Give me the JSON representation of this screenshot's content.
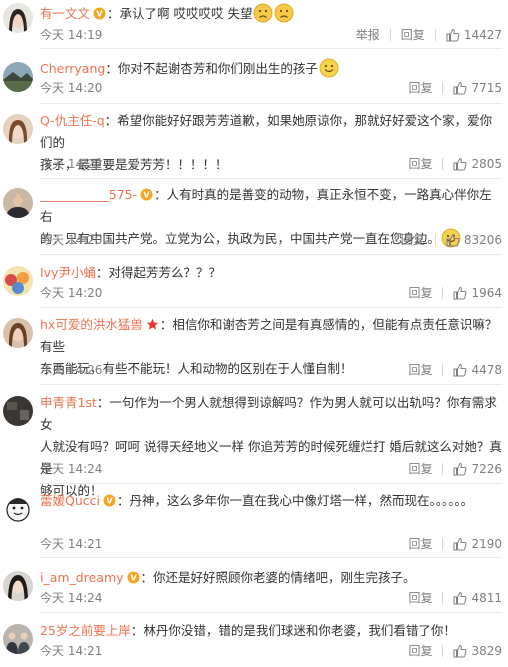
{
  "actions": {
    "report": "举报",
    "reply": "回复"
  },
  "comments": [
    {
      "user": "有一文文",
      "text": "：承认了啊 哎哎哎哎 失望",
      "lines": [
        "：承认了啊 哎哎哎哎 失望"
      ],
      "emoji": [
        "sad-face",
        "sad-face"
      ],
      "time": "今天 14:19",
      "likes": "14427",
      "show_report": true,
      "avatar": "woman-dark-hair"
    },
    {
      "user": "Cherryang",
      "text": "：你对不起谢杏芳和你们刚出生的孩子",
      "lines": [
        "：你对不起谢杏芳和你们刚出生的孩子"
      ],
      "emoji": [
        "smile-face"
      ],
      "time": "今天 14:20",
      "likes": "7715",
      "show_report": false,
      "avatar": "landscape"
    },
    {
      "user": "Q-仇主任-q",
      "text": "：希望你能好好跟芳芳道歉，如果她原谅你，那就好好爱这个家，爱你们的孩子，最重要是爱芳芳！！！！！",
      "lines": [
        "：希望你能好好跟芳芳道歉，如果她原谅你，那就好好爱这个家，爱你们的",
        "孩子，最重要是爱芳芳！！！！！"
      ],
      "emoji": [],
      "time": "今天 14:22",
      "likes": "2805",
      "show_report": false,
      "avatar": "woman-portrait"
    },
    {
      "user": "___________575-",
      "text": "：人有时真的是善变的动物，真正永恒不变，一路真心伴你左右的：只有中国共产党。立党为公，执政为民，中国共产党一直在您身边。",
      "lines": [
        "：人有时真的是善变的动物，真正永恒不变，一路真心伴你左右",
        "的：只有中国共产党。立党为公，执政为民，中国共产党一直在您身边。"
      ],
      "emoji": [
        "smile-face"
      ],
      "time": "今天 14:20",
      "likes": "83206",
      "show_report": false,
      "avatar": "man-suit"
    },
    {
      "user": "Ivy尹小蛹",
      "text": "：对得起芳芳么？？？",
      "lines": [
        "：对得起芳芳么？？？"
      ],
      "emoji": [],
      "time": "今天 14:20",
      "likes": "1964",
      "show_report": false,
      "avatar": "cartoon-group"
    },
    {
      "user": "hx可爱的洪水猛兽",
      "text": "：相信你和谢杏芳之间是有真感情的，但能有点责任意识嘛？有些东西能玩，有些不能玩！人和动物的区别在于人懂自制！",
      "lines": [
        "：相信你和谢杏芳之间是有真感情的，但能有点责任意识嘛？有些",
        "东西能玩，有些不能玩！人和动物的区别在于人懂自制！"
      ],
      "emoji": [],
      "time": "今天 14:26",
      "likes": "4478",
      "show_report": false,
      "avatar": "woman-brown-hair",
      "badge": "star"
    },
    {
      "user": "申青青1st",
      "text": "：一句作为一个男人就想得到谅解吗？作为男人就可以出轨吗？你有需求女人就没有吗？呵呵 说得天经地义一样 你追芳芳的时候死缠烂打 婚后就这么对她？真是够可以的！",
      "lines": [
        "：一句作为一个男人就想得到谅解吗？作为男人就可以出轨吗？你有需求女",
        "人就没有吗？呵呵 说得天经地义一样 你追芳芳的时候死缠烂打 婚后就这么对她？真是",
        "够可以的！"
      ],
      "emoji": [],
      "time": "今天 14:24",
      "likes": "7226",
      "show_report": false,
      "avatar": "dark-room"
    },
    {
      "user": "蕾嫒Qucci",
      "text": "：丹神，这么多年你一直在我心中像灯塔一样，然而现在。。。。。。",
      "lines": [
        "：丹神，这么多年你一直在我心中像灯塔一样，然而现在。。。。。。"
      ],
      "emoji": [],
      "time": "今天 14:21",
      "likes": "2190",
      "show_report": false,
      "avatar": "cartoon-face"
    },
    {
      "user": "i_am_dreamy",
      "text": "：你还是好好照顾你老婆的情绪吧，刚生完孩子。",
      "lines": [
        "：你还是好好照顾你老婆的情绪吧，刚生完孩子。"
      ],
      "emoji": [],
      "time": "今天 14:24",
      "likes": "4811",
      "show_report": false,
      "avatar": "woman-long-hair"
    },
    {
      "user": "25岁之前要上岸",
      "text": "：林丹你没错，错的是我们球迷和你老婆，我们看错了你！",
      "lines": [
        "：林丹你没错，错的是我们球迷和你老婆，我们看错了你！"
      ],
      "emoji": [],
      "time": "今天 14:21",
      "likes": "3829",
      "show_report": false,
      "avatar": "man-group"
    }
  ]
}
